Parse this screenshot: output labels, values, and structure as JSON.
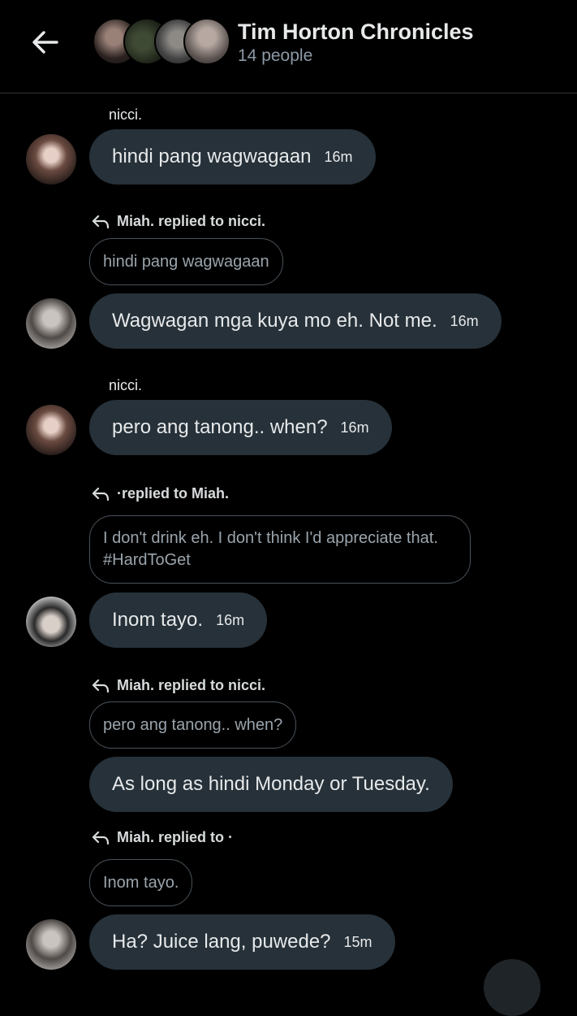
{
  "header": {
    "title": "Tim Horton Chronicles",
    "subtitle": "14 people",
    "back_icon": "arrow-left-icon"
  },
  "messages": [
    {
      "sender": "nicci.",
      "text": "hindi pang wagwagaan",
      "time": "16m",
      "avatar": "avatar-woman-1"
    },
    {
      "reply_meta": "Miah. replied to nicci.",
      "quote": "hindi pang wagwagaan",
      "text": "Wagwagan mga kuya mo eh. Not me.",
      "time": "16m",
      "avatar": "avatar-man-1"
    },
    {
      "sender": "nicci.",
      "text": "pero ang tanong.. when?",
      "time": "16m",
      "avatar": "avatar-woman-1"
    },
    {
      "reply_meta": "·replied to Miah.",
      "quote": "I don't drink eh. I don't think I'd appreciate that. #HardToGet",
      "text": "Inom tayo.",
      "time": "16m",
      "avatar": "avatar-man-2"
    },
    {
      "reply_meta": "Miah. replied to nicci.",
      "quote": "pero ang tanong.. when?",
      "text": "As long as hindi Monday or Tuesday.",
      "time": ""
    },
    {
      "reply_meta": "Miah. replied to ·",
      "quote": "Inom tayo.",
      "text": "Ha? Juice lang, puwede?",
      "time": "15m",
      "avatar": "avatar-man-1"
    }
  ],
  "colors": {
    "bubble": "#263139",
    "background": "#000000",
    "muted": "#8b98a5"
  }
}
